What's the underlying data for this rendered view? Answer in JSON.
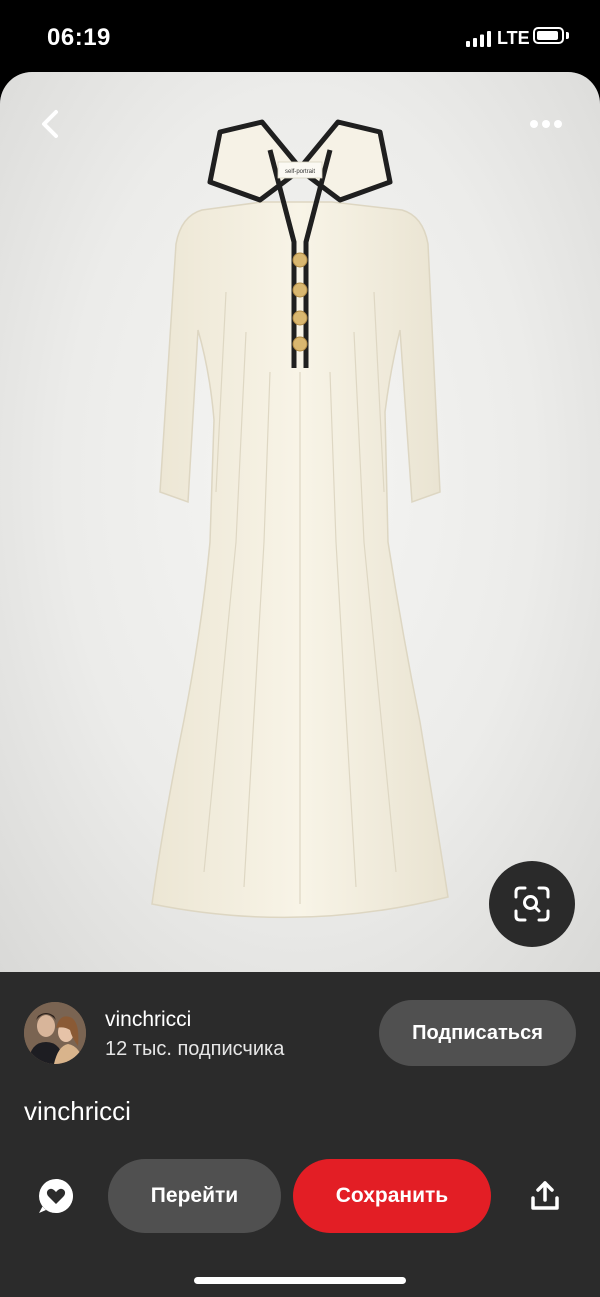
{
  "status_bar": {
    "time": "06:19",
    "network": "LTE"
  },
  "pin": {
    "image_label": "self-portrait",
    "author": {
      "name": "vinchricci",
      "followers": "12 тыс. подписчика"
    },
    "subscribe_label": "Подписаться",
    "title": "vinchricci"
  },
  "actions": {
    "go_label": "Перейти",
    "save_label": "Сохранить"
  },
  "colors": {
    "save": "#e31e25",
    "secondary_button": "#505050",
    "sheet": "#2b2b2b"
  }
}
